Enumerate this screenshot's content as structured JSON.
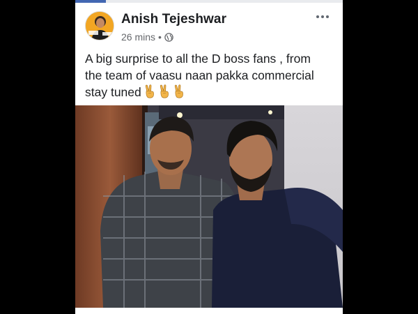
{
  "post": {
    "author_name": "Anish Tejeshwar",
    "timestamp": "26 mins",
    "separator": "•",
    "privacy_icon": "globe-icon",
    "more_icon": "more-horizontal-icon",
    "text_lines": [
      "A big surprise to all the D boss fans , from",
      "the team of vaasu naan pakka commercial",
      "stay tuned"
    ],
    "emoji_icon": "victory-hand-emoji",
    "emoji_count": 3,
    "photo_icon": "post-photo"
  },
  "colors": {
    "card_background": "#ffffff",
    "page_background": "#000000",
    "author_text": "#1c1e21",
    "meta_text": "#65676b",
    "accent": "#4267b2"
  }
}
